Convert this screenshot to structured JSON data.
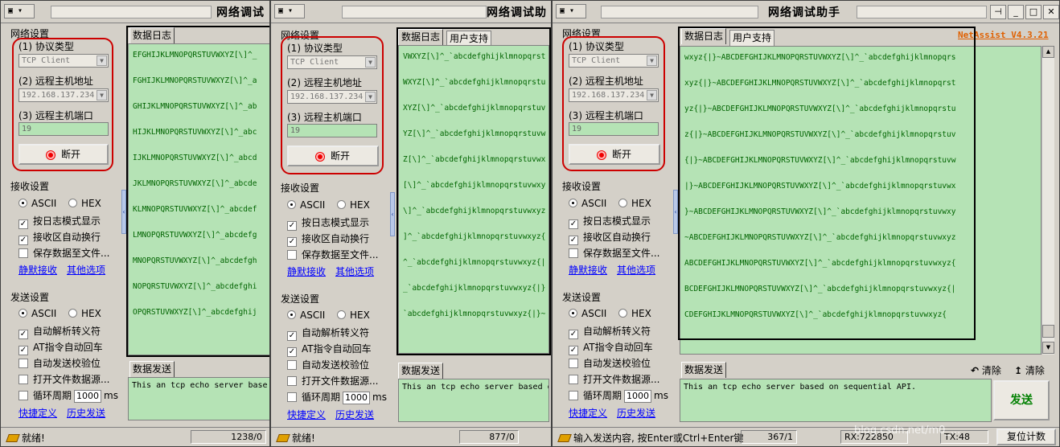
{
  "app": {
    "title_w1": "网络调试",
    "title_w2": "网络调试助",
    "title_w3": "网络调试助手",
    "version": "NetAssist V4.3.21",
    "sys_menu_glyph": "▾"
  },
  "network": {
    "group_title": "网络设置",
    "protocol_label": "(1) 协议类型",
    "protocol_value": "TCP Client",
    "host_label": "(2) 远程主机地址",
    "host_value": "192.168.137.234",
    "port_label": "(3) 远程主机端口",
    "port_value": "19",
    "disconnect_label": "断开"
  },
  "receive": {
    "group_title": "接收设置",
    "ascii": "ASCII",
    "hex": "HEX",
    "log_mode": "按日志模式显示",
    "auto_wrap": "接收区自动换行",
    "save_file": "保存数据至文件...",
    "silent_link": "静默接收",
    "other_link": "其他选项"
  },
  "send": {
    "group_title": "发送设置",
    "ascii": "ASCII",
    "hex": "HEX",
    "auto_escape": "自动解析转义符",
    "at_cr": "AT指令自动回车",
    "auto_checksum": "自动发送校验位",
    "open_file": "打开文件数据源...",
    "loop": "循环周期",
    "loop_value": "1000",
    "loop_unit": "ms",
    "shortcut_link": "快捷定义",
    "history_link": "历史发送"
  },
  "tabs": {
    "log": "数据日志",
    "support": "用户支持",
    "send": "数据发送",
    "clear1": "清除",
    "clear2": "清除",
    "send_button": "发送"
  },
  "log_w1": [
    "EFGHIJKLMNOPQRSTUVWXYZ[\\]^_",
    "FGHIJKLMNOPQRSTUVWXYZ[\\]^_a",
    "GHIJKLMNOPQRSTUVWXYZ[\\]^_ab",
    "HIJKLMNOPQRSTUVWXYZ[\\]^_abc",
    "IJKLMNOPQRSTUVWXYZ[\\]^_abcd",
    "JKLMNOPQRSTUVWXYZ[\\]^_abcde",
    "KLMNOPQRSTUVWXYZ[\\]^_abcdef",
    "LMNOPQRSTUVWXYZ[\\]^_abcdefg",
    "MNOPQRSTUVWXYZ[\\]^_abcdefgh",
    "NOPQRSTUVWXYZ[\\]^_abcdefghi",
    "OPQRSTUVWXYZ[\\]^_abcdefghij"
  ],
  "log_w2": [
    "VWXYZ[\\]^_`abcdefghijklmnopqrst",
    "WXYZ[\\]^_`abcdefghijklmnopqrstu",
    "XYZ[\\]^_`abcdefghijklmnopqrstuv",
    "YZ[\\]^_`abcdefghijklmnopqrstuvw",
    "Z[\\]^_`abcdefghijklmnopqrstuvwx",
    "[\\]^_`abcdefghijklmnopqrstuvwxy",
    "\\]^_`abcdefghijklmnopqrstuvwxyz",
    "]^_`abcdefghijklmnopqrstuvwxyz{",
    "^_`abcdefghijklmnopqrstuvwxyz{|",
    "_`abcdefghijklmnopqrstuvwxyz{|}",
    "`abcdefghijklmnopqrstuvwxyz{|}~"
  ],
  "log_w3": [
    "wxyz{|}~ABCDEFGHIJKLMNOPQRSTUVWXYZ[\\]^_`abcdefghijklmnopqrs",
    "xyz{|}~ABCDEFGHIJKLMNOPQRSTUVWXYZ[\\]^_`abcdefghijklmnopqrst",
    "yz{|}~ABCDEFGHIJKLMNOPQRSTUVWXYZ[\\]^_`abcdefghijklmnopqrstu",
    "z{|}~ABCDEFGHIJKLMNOPQRSTUVWXYZ[\\]^_`abcdefghijklmnopqrstuv",
    "{|}~ABCDEFGHIJKLMNOPQRSTUVWXYZ[\\]^_`abcdefghijklmnopqrstuvw",
    "|}~ABCDEFGHIJKLMNOPQRSTUVWXYZ[\\]^_`abcdefghijklmnopqrstuvwx",
    "}~ABCDEFGHIJKLMNOPQRSTUVWXYZ[\\]^_`abcdefghijklmnopqrstuvwxy",
    "~ABCDEFGHIJKLMNOPQRSTUVWXYZ[\\]^_`abcdefghijklmnopqrstuvwxyz",
    "ABCDEFGHIJKLMNOPQRSTUVWXYZ[\\]^_`abcdefghijklmnopqrstuvwxyz{",
    "BCDEFGHIJKLMNOPQRSTUVWXYZ[\\]^_`abcdefghijklmnopqrstuvwxyz{|",
    "CDEFGHIJKLMNOPQRSTUVWXYZ[\\]^_`abcdefghijklmnopqrstuvwxyz{"
  ],
  "send_text": "This an tcp echo server based on sequential API.",
  "send_text_w1": "This an tcp echo server base",
  "send_text_w2": "This an tcp echo server based o",
  "status": {
    "ready": "就绪!",
    "counter_w1": "1238/0",
    "counter_w2": "877/0",
    "hint_w3": "输入发送内容, 按Enter或Ctrl+Enter键",
    "counter_w3": "367/1",
    "rx": "RX:722850",
    "tx": "TX:48",
    "reset": "复位计数"
  },
  "watermark": "blog.csdn.net/m0_..."
}
